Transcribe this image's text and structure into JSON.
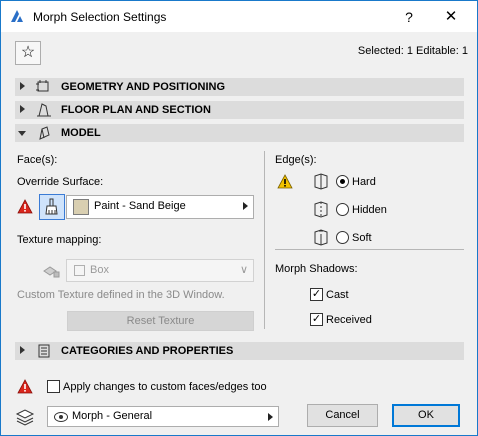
{
  "window": {
    "title": "Morph Selection Settings",
    "help": "?",
    "close": "✕"
  },
  "selection_info": "Selected: 1 Editable: 1",
  "sections": {
    "geometry": "GEOMETRY AND POSITIONING",
    "floor_plan": "FLOOR PLAN AND SECTION",
    "model": "MODEL",
    "categories": "CATEGORIES AND PROPERTIES"
  },
  "model": {
    "faces_label": "Face(s):",
    "override_label": "Override Surface:",
    "surface_value": "Paint - Sand Beige",
    "surface_color": "#d9cfb1",
    "texture_mapping_label": "Texture mapping:",
    "texture_value": "Box",
    "texture_note": "Custom Texture defined in the 3D Window.",
    "reset_texture": "Reset Texture",
    "edges_label": "Edge(s):",
    "edges": [
      {
        "label": "Hard",
        "selected": true
      },
      {
        "label": "Hidden",
        "selected": false
      },
      {
        "label": "Soft",
        "selected": false
      }
    ],
    "shadows_label": "Morph Shadows:",
    "cast": "Cast",
    "received": "Received",
    "cast_checked": true,
    "received_checked": true
  },
  "footer": {
    "apply_label": "Apply changes to custom faces/edges too",
    "apply_checked": false,
    "profile": "Morph - General",
    "cancel": "Cancel",
    "ok": "OK"
  },
  "colors": {
    "accent": "#0078d7",
    "warning": "#d9261c",
    "section_bg": "#dcdcdc"
  }
}
